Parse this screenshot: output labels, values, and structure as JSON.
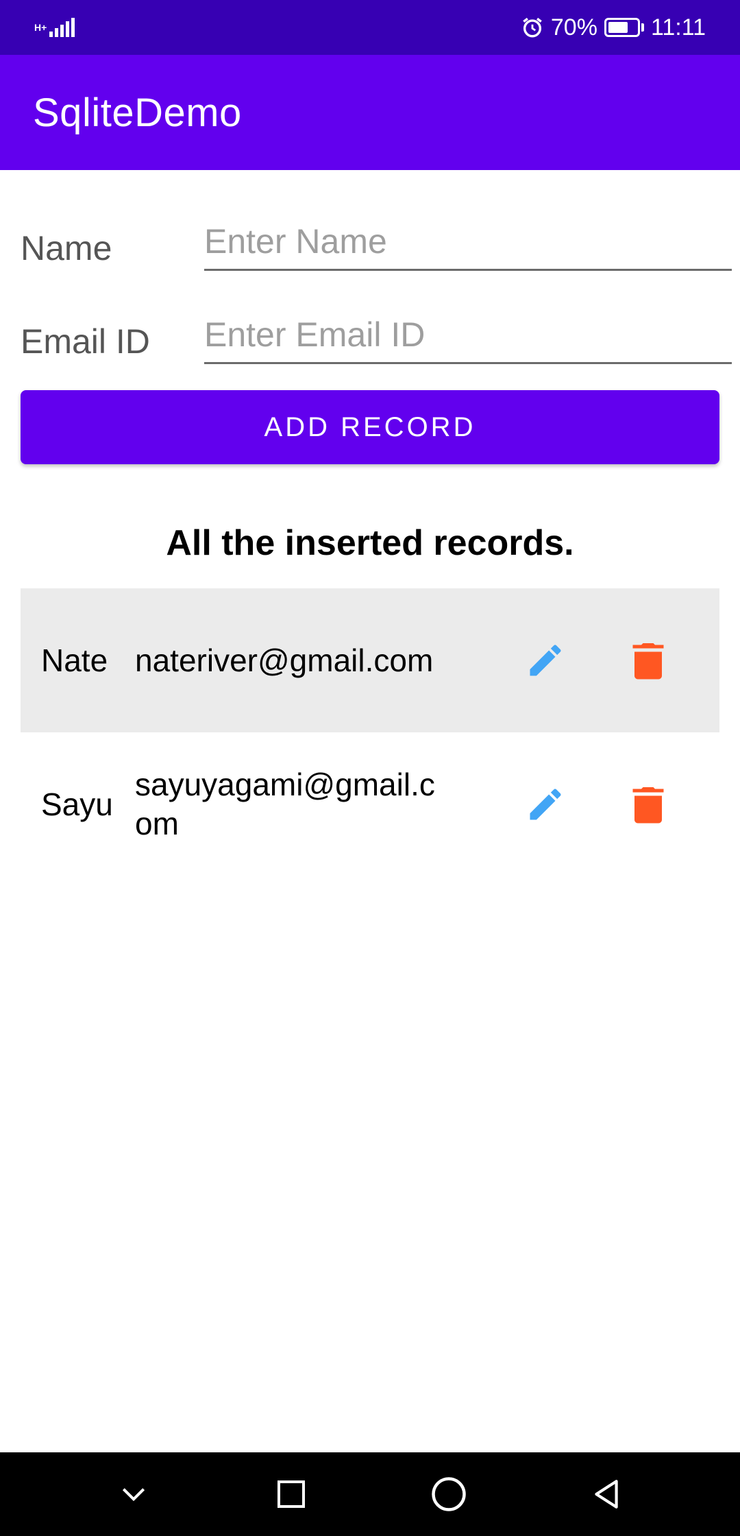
{
  "status_bar": {
    "network_type": "H+",
    "battery_percent": "70%",
    "battery_level": 0.7,
    "time": "11:11",
    "icons": [
      "signal-icon",
      "alarm-icon",
      "battery-icon"
    ]
  },
  "app_bar": {
    "title": "SqliteDemo"
  },
  "form": {
    "name_label": "Name",
    "name_placeholder": "Enter Name",
    "name_value": "",
    "email_label": "Email ID",
    "email_placeholder": "Enter Email ID",
    "email_value": "",
    "add_button_label": "ADD RECORD"
  },
  "records": {
    "heading": "All the inserted records.",
    "items": [
      {
        "name": "Nate",
        "email": "nateriver@gmail.com",
        "edit_icon": "edit-icon",
        "delete_icon": "delete-icon"
      },
      {
        "name": "Sayu",
        "email": "sayuyagami@gmail.com",
        "edit_icon": "edit-icon",
        "delete_icon": "delete-icon"
      }
    ]
  },
  "colors": {
    "status_bar": "#3700b3",
    "primary": "#6200ee",
    "edit_icon": "#42a5f5",
    "delete_icon": "#ff5722",
    "row_shade": "#ebebeb"
  },
  "nav_bar": {
    "buttons": [
      "collapse-icon",
      "recents-icon",
      "home-icon",
      "back-icon"
    ]
  }
}
